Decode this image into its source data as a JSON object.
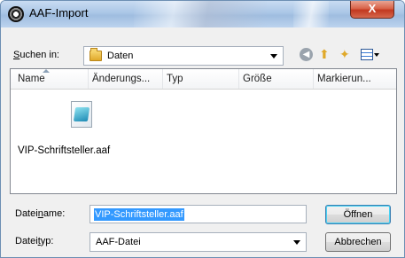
{
  "window": {
    "title": "AAF-Import",
    "close_glyph": "X"
  },
  "lookin": {
    "label_prefix": "S",
    "label_rest": "uchen in:",
    "value": "Daten"
  },
  "columns": [
    "Name",
    "Änderungs...",
    "Typ",
    "Größe",
    "Markierun..."
  ],
  "files": [
    {
      "name": "VIP-Schriftsteller.aaf",
      "icon": "aaf-file-icon"
    }
  ],
  "filename": {
    "label_a": "Datei",
    "label_u": "n",
    "label_b": "ame:",
    "value": "VIP-Schriftsteller.aaf"
  },
  "filetype": {
    "label_a": "Datei",
    "label_u": "t",
    "label_b": "yp:",
    "value": "AAF-Datei"
  },
  "buttons": {
    "open": "Öffnen",
    "cancel": "Abbrechen"
  },
  "toolbar": {
    "back_icon": "back-icon",
    "up_icon": "up-folder-icon",
    "new_folder_icon": "new-folder-icon",
    "view_icon": "view-menu-icon"
  }
}
